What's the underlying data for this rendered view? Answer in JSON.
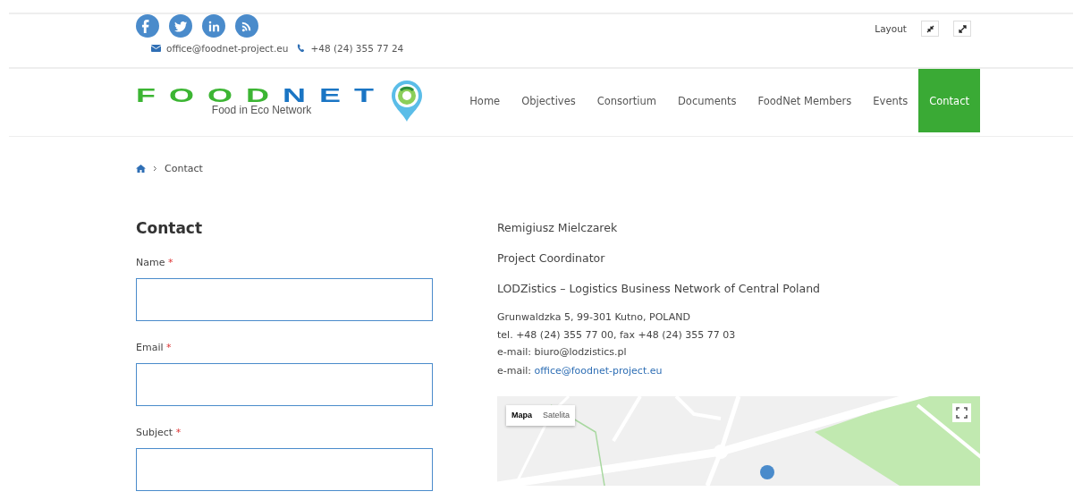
{
  "social_links": [
    {
      "kind": "facebook"
    },
    {
      "kind": "twitter"
    },
    {
      "kind": "linkedin"
    },
    {
      "kind": "rss"
    }
  ],
  "contact_bar": {
    "email": "office@foodnet-project.eu",
    "phone": "+48 (24) 355 77 24"
  },
  "layout_switch": {
    "label": "Layout"
  },
  "logo": {
    "parts": [
      "FOOD",
      "NET"
    ],
    "tagline": "Food in Eco Network"
  },
  "nav": [
    {
      "label": "Home",
      "selected": false
    },
    {
      "label": "Objectives",
      "selected": false
    },
    {
      "label": "Consortium",
      "selected": false
    },
    {
      "label": "Documents",
      "selected": false
    },
    {
      "label": "FoodNet Members",
      "selected": false
    },
    {
      "label": "Events",
      "selected": false
    },
    {
      "label": "Contact",
      "selected": true
    }
  ],
  "breadcrumb": [
    "Contact"
  ],
  "form": {
    "title": "Contact",
    "fields": [
      {
        "label": "Name",
        "required_mark": "*"
      },
      {
        "label": "Email",
        "required_mark": "*"
      },
      {
        "label": "Subject",
        "required_mark": "*"
      }
    ]
  },
  "info": {
    "name": "Remigiusz Mielczarek",
    "role": "Project Coordinator",
    "organization": "LODZistics – Logistics Business Network of Central Poland",
    "address_lines": [
      "Grunwaldzka 5, 99-301 Kutno, POLAND",
      "tel. +48 (24) 355 77 00, fax +48 (24) 355 77 03",
      "e-mail: biuro@lodzistics.pl"
    ],
    "email_label": "e-mail:",
    "email_link": "office@foodnet-project.eu"
  },
  "map": {
    "types": [
      {
        "label": "Mapa",
        "selected": true
      },
      {
        "label": "Satelita",
        "selected": false
      }
    ]
  }
}
